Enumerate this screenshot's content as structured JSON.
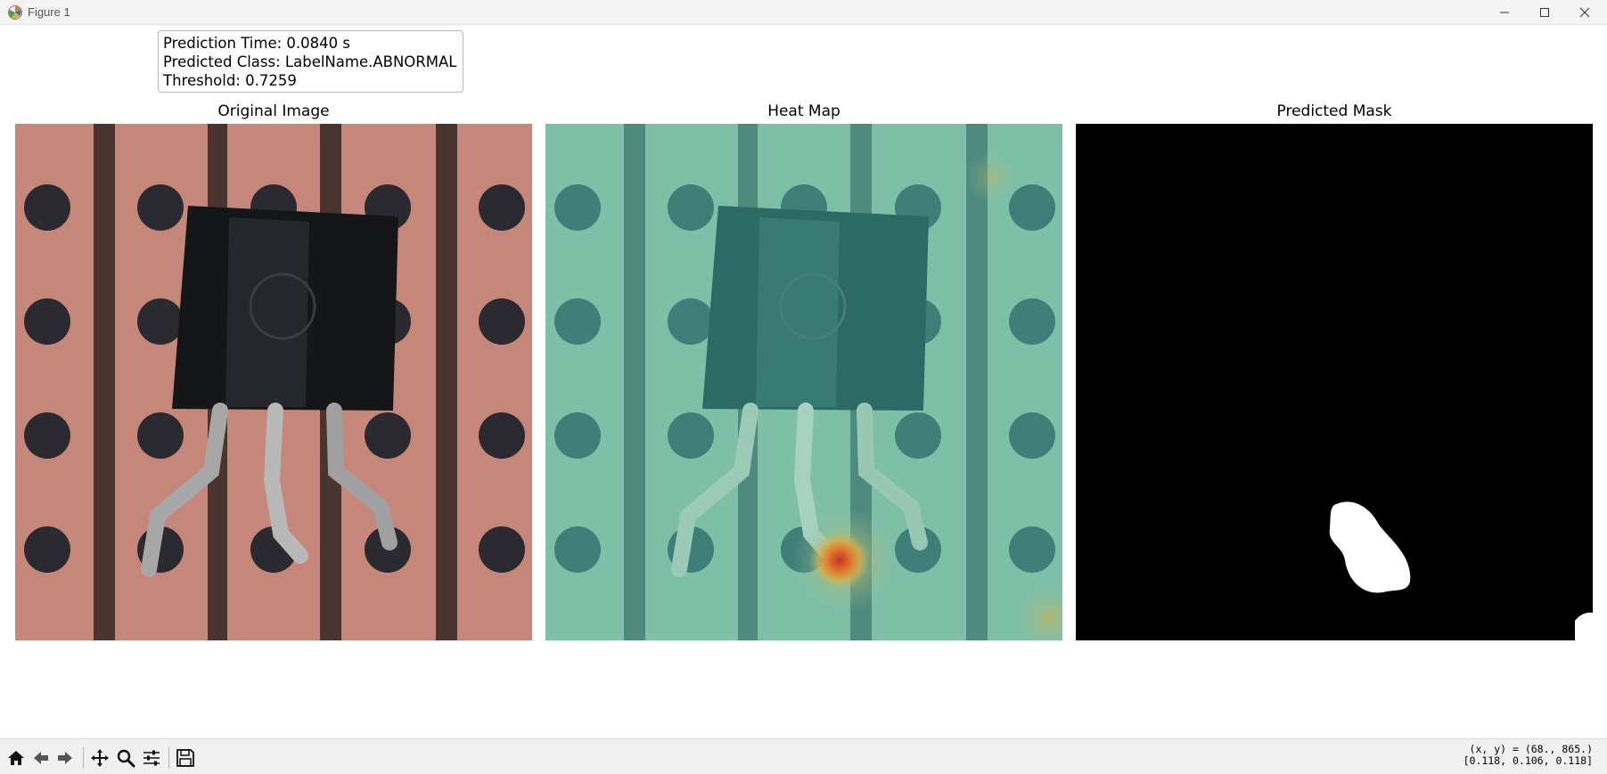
{
  "window": {
    "title": "Figure 1",
    "icon": "matplotlib-icon",
    "controls": [
      "minimize-icon",
      "maximize-icon",
      "close-icon"
    ]
  },
  "info": {
    "prediction_time": "Prediction Time: 0.0840 s",
    "predicted_class": "Predicted Class: LabelName.ABNORMAL",
    "threshold": "Threshold: 0.7259"
  },
  "panels": [
    {
      "title": "Original Image"
    },
    {
      "title": "Heat Map"
    },
    {
      "title": "Predicted Mask"
    }
  ],
  "toolbar": {
    "tools": [
      "home-icon",
      "back-icon",
      "forward-icon",
      "pan-icon",
      "zoom-icon",
      "configure-subplots-icon",
      "save-icon"
    ],
    "coords_line1": "(x, y) = (68., 865.)",
    "coords_line2": "[0.118, 0.106, 0.118]"
  },
  "colors": {
    "pcb": "#c5877a",
    "heat_overlay": "#7ebfa8",
    "mask_bg": "#000000",
    "mask_fg": "#ffffff"
  }
}
